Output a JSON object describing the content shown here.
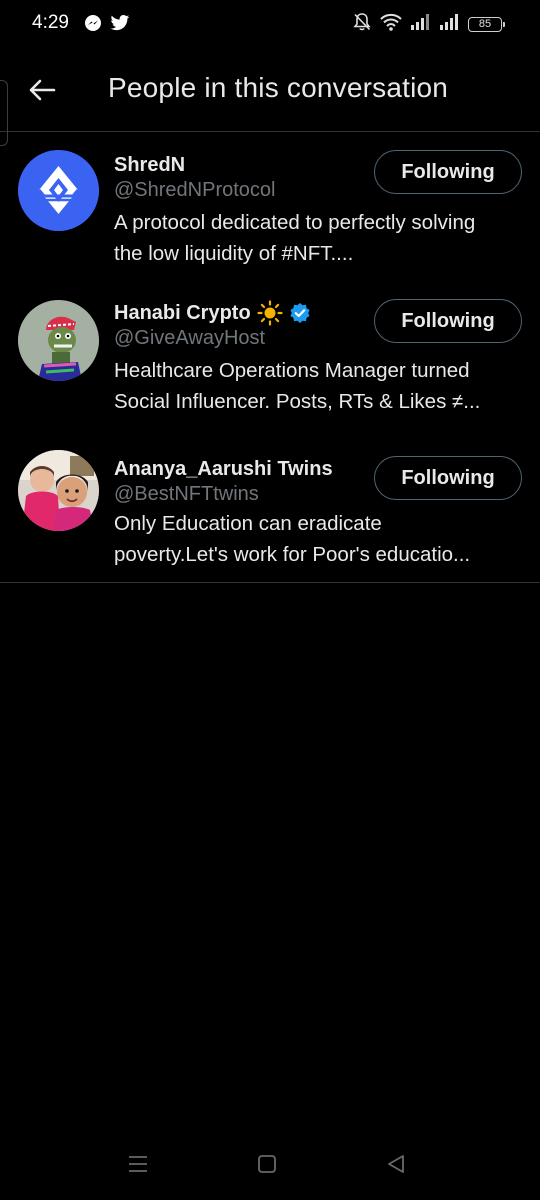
{
  "status_bar": {
    "time": "4:29",
    "battery": "85",
    "left_icons": [
      "messenger-icon",
      "twitter-bird-icon"
    ],
    "right_icons": [
      "mute-bell-icon",
      "wifi-icon",
      "signal-icon",
      "signal-icon"
    ]
  },
  "header": {
    "title": "People in this conversation",
    "back_icon": "arrow-left-icon"
  },
  "people": [
    {
      "name": "ShredN",
      "handle": "@ShredNProtocol",
      "bio_lines": [
        "A protocol dedicated to perfectly solving",
        "the low liquidity of #NFT...."
      ],
      "button_label": "Following",
      "avatar_color": "#3b63f2"
    },
    {
      "name": "Hanabi Crypto",
      "name_emoji": "☀️",
      "verified": true,
      "handle": "@GiveAwayHost",
      "bio_lines": [
        "Healthcare Operations Manager turned",
        "Social Influencer. Posts, RTs & Likes ≠..."
      ],
      "button_label": "Following",
      "avatar_color": "#9aa89a"
    },
    {
      "name": "Ananya_Aarushi Twins",
      "handle": "@BestNFTtwins",
      "bio_lines": [
        "Only Education can eradicate",
        "poverty.Let's work for Poor's educatio..."
      ],
      "button_label": "Following",
      "avatar_color": "#c24a6a"
    }
  ],
  "nav_bar": {
    "icons": [
      "menu-icon",
      "home-square-icon",
      "back-triangle-icon"
    ]
  },
  "colors": {
    "background": "#000000",
    "text_primary": "#e7e9ea",
    "text_secondary": "#71767b",
    "divider": "#2f3336",
    "verified_blue": "#1d9bf0",
    "button_border": "#536471"
  }
}
